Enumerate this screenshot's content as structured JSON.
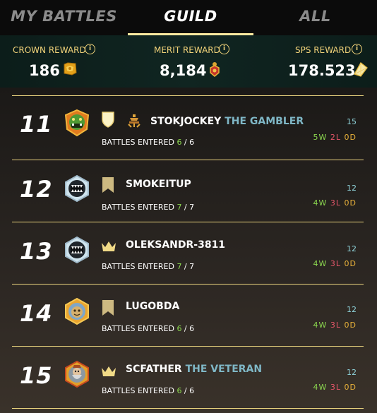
{
  "tabs": [
    {
      "label": "MY BATTLES",
      "active": false
    },
    {
      "label": "GUILD",
      "active": true
    },
    {
      "label": "ALL",
      "active": false
    }
  ],
  "rewards": [
    {
      "label": "CROWN REWARD",
      "value": "186",
      "icon": "crown-reward-icon"
    },
    {
      "label": "MERIT REWARD",
      "value": "8,184",
      "icon": "merit-reward-icon"
    },
    {
      "label": "SPS REWARD",
      "value": "178.523",
      "icon": "sps-reward-icon"
    }
  ],
  "info_glyph": "i",
  "entered_label": "BATTLES ENTERED",
  "rows": [
    {
      "rank": "11",
      "name": "STOKJOCKEY",
      "title": "THE GAMBLER",
      "entered": "6",
      "total": "6",
      "score": "15",
      "w": "5",
      "l": "2",
      "d": "0",
      "rank_badge": "shield",
      "avatar": "green-orc"
    },
    {
      "rank": "12",
      "name": "SMOKEITUP",
      "title": "",
      "entered": "7",
      "total": "7",
      "score": "12",
      "w": "4",
      "l": "3",
      "d": "0",
      "rank_badge": "banner",
      "avatar": "monster-mouth"
    },
    {
      "rank": "13",
      "name": "OLEKSANDR-3811",
      "title": "",
      "entered": "7",
      "total": "7",
      "score": "12",
      "w": "4",
      "l": "3",
      "d": "0",
      "rank_badge": "crown",
      "avatar": "monster-mouth"
    },
    {
      "rank": "14",
      "name": "LUGOBDA",
      "title": "",
      "entered": "6",
      "total": "6",
      "score": "12",
      "w": "4",
      "l": "3",
      "d": "0",
      "rank_badge": "banner",
      "avatar": "gold-ball"
    },
    {
      "rank": "15",
      "name": "SCFATHER",
      "title": "THE VETERAN",
      "entered": "6",
      "total": "6",
      "score": "12",
      "w": "4",
      "l": "3",
      "d": "0",
      "rank_badge": "crown",
      "avatar": "dwarf"
    }
  ],
  "wld_letters": {
    "w": "W",
    "l": "L",
    "d": "D"
  },
  "colors": {
    "accent_gold": "#f2d37a",
    "win": "#8bd64f",
    "loss": "#e8576b",
    "draw": "#e8b13a",
    "title_blue": "#7fb7c6",
    "score": "#8fd3da"
  }
}
